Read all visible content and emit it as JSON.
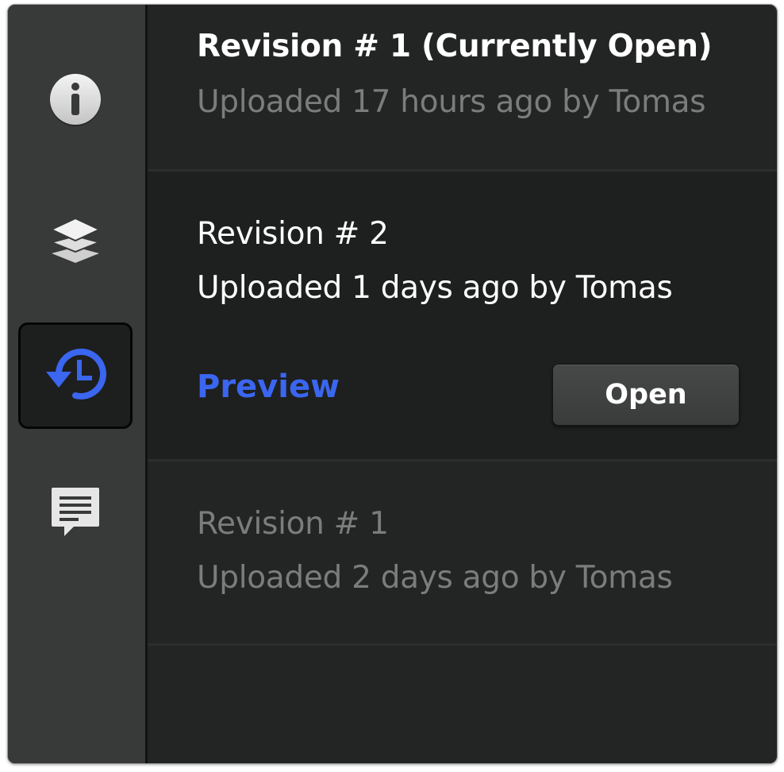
{
  "sidebar": {
    "items": [
      {
        "name": "info",
        "icon": "info-icon",
        "active": false
      },
      {
        "name": "layers",
        "icon": "layers-icon",
        "active": false
      },
      {
        "name": "revisions",
        "icon": "history-icon",
        "active": true
      },
      {
        "name": "comments",
        "icon": "comment-icon",
        "active": false
      }
    ]
  },
  "revisions": [
    {
      "title": "Revision # 1 (Currently Open)",
      "subtitle": "Uploaded 17 hours ago by Tomas",
      "state": "current"
    },
    {
      "title": "Revision # 2",
      "subtitle": "Uploaded 1 days ago by Tomas",
      "state": "selected",
      "preview_label": "Preview",
      "open_label": "Open"
    },
    {
      "title": "Revision # 1",
      "subtitle": "Uploaded 2 days ago by Tomas",
      "state": "older"
    }
  ],
  "colors": {
    "accent": "#3a66f0",
    "panel_bg": "#232424",
    "sidebar_bg": "#383939",
    "muted_text": "#7b7c7c"
  }
}
